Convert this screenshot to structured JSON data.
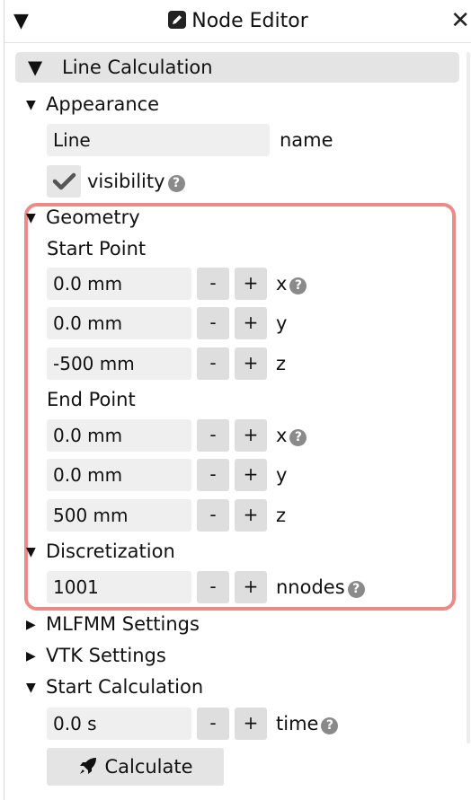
{
  "window": {
    "title": "Node Editor"
  },
  "main_section": {
    "label": "Line Calculation"
  },
  "appearance": {
    "label": "Appearance",
    "name_value": "Line",
    "name_label": "name",
    "visibility_label": "visibility"
  },
  "geometry": {
    "label": "Geometry",
    "start": {
      "label": "Start Point",
      "x": {
        "value": "0.0 mm",
        "axis": "x"
      },
      "y": {
        "value": "0.0 mm",
        "axis": "y"
      },
      "z": {
        "value": "-500 mm",
        "axis": "z"
      }
    },
    "end": {
      "label": "End Point",
      "x": {
        "value": "0.0 mm",
        "axis": "x"
      },
      "y": {
        "value": "0.0 mm",
        "axis": "y"
      },
      "z": {
        "value": "500 mm",
        "axis": "z"
      }
    }
  },
  "discretization": {
    "label": "Discretization",
    "value": "1001",
    "param": "nnodes"
  },
  "mlfmm": {
    "label": "MLFMM Settings"
  },
  "vtk": {
    "label": "VTK Settings"
  },
  "start_calc": {
    "label": "Start Calculation",
    "time_value": "0.0 s",
    "time_label": "time",
    "button_label": "Calculate"
  },
  "stepper": {
    "minus": "-",
    "plus": "+"
  },
  "icons": {
    "help": "?",
    "collapse": "▼",
    "close": "✕"
  },
  "colors": {
    "highlight": "#ec8a86",
    "field_bg": "#efefef",
    "button_bg": "#dedede"
  }
}
